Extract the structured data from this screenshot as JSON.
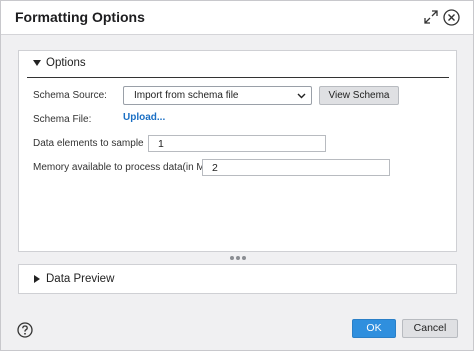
{
  "dialog": {
    "title": "Formatting Options"
  },
  "options_section": {
    "label": "Options",
    "expanded": true,
    "schema_source": {
      "label": "Schema Source:",
      "selected": "Import from schema file"
    },
    "view_schema_label": "View Schema",
    "schema_file": {
      "label": "Schema File:",
      "link_text": "Upload..."
    },
    "data_elements": {
      "label": "Data elements to sample",
      "value": "1"
    },
    "memory": {
      "label": "Memory available to process data(in MB)",
      "value": "2"
    }
  },
  "preview_section": {
    "label": "Data Preview",
    "expanded": false
  },
  "footer": {
    "ok_label": "OK",
    "cancel_label": "Cancel"
  },
  "colors": {
    "primary": "#2f8fde",
    "link": "#1a6fc4"
  },
  "icons": [
    "expand-icon",
    "close-icon",
    "caret-down-icon",
    "caret-right-icon",
    "chevron-down-icon",
    "help-icon"
  ]
}
